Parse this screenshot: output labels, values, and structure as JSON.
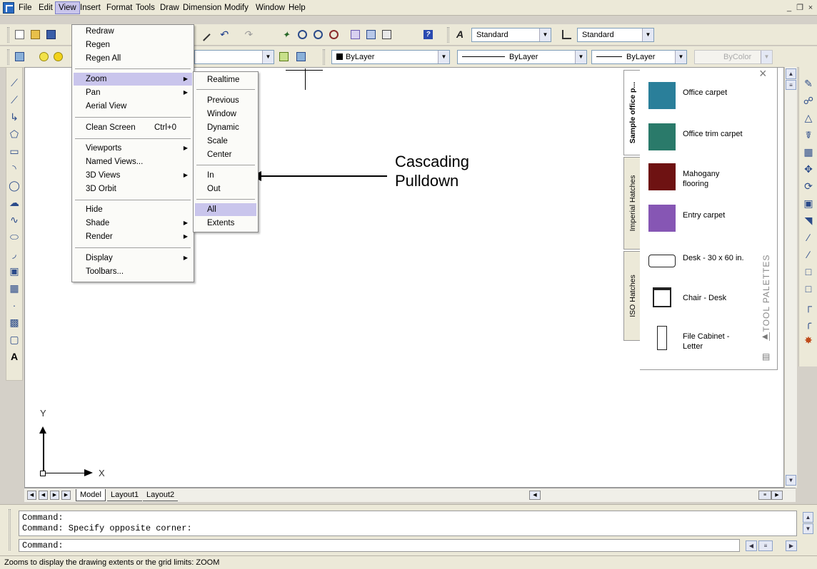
{
  "menubar": {
    "items": [
      "File",
      "Edit",
      "View",
      "Insert",
      "Format",
      "Tools",
      "Draw",
      "Dimension",
      "Modify",
      "Window",
      "Help"
    ],
    "window_controls": [
      "_",
      "ɗ",
      "×"
    ]
  },
  "toolbar": {
    "text_style": "Standard",
    "dim_style": "Standard",
    "layer_color": "ByLayer",
    "linetype": "ByLayer",
    "lineweight": "ByLayer",
    "plot_style": "ByColor"
  },
  "view_menu": {
    "groups": [
      [
        {
          "label": "Redraw"
        },
        {
          "label": "Regen"
        },
        {
          "label": "Regen All"
        }
      ],
      [
        {
          "label": "Zoom",
          "submenu": true,
          "highlighted": true
        },
        {
          "label": "Pan",
          "submenu": true
        },
        {
          "label": "Aerial View"
        }
      ],
      [
        {
          "label": "Clean Screen",
          "shortcut": "Ctrl+0"
        }
      ],
      [
        {
          "label": "Viewports",
          "submenu": true
        },
        {
          "label": "Named Views..."
        },
        {
          "label": "3D Views",
          "submenu": true
        },
        {
          "label": "3D Orbit"
        }
      ],
      [
        {
          "label": "Hide"
        },
        {
          "label": "Shade",
          "submenu": true
        },
        {
          "label": "Render",
          "submenu": true
        }
      ],
      [
        {
          "label": "Display",
          "submenu": true
        },
        {
          "label": "Toolbars..."
        }
      ]
    ]
  },
  "zoom_menu": {
    "groups": [
      [
        {
          "label": "Realtime"
        }
      ],
      [
        {
          "label": "Previous"
        },
        {
          "label": "Window"
        },
        {
          "label": "Dynamic"
        },
        {
          "label": "Scale"
        },
        {
          "label": "Center"
        }
      ],
      [
        {
          "label": "In"
        },
        {
          "label": "Out"
        }
      ],
      [
        {
          "label": "All",
          "highlighted": true
        },
        {
          "label": "Extents"
        }
      ]
    ]
  },
  "annotation": {
    "line1": "Cascading",
    "line2": "Pulldown"
  },
  "palette": {
    "tabs": [
      "Sample office p...",
      "Imperial Hatches",
      "ISO Hatches"
    ],
    "title": "TOOL PALETTES",
    "items": [
      {
        "label": "Office carpet",
        "color": "#2a7f9a"
      },
      {
        "label": "Office trim carpet",
        "color": "#2a7a6a"
      },
      {
        "label": "Mahogany flooring",
        "color": "#6e1212"
      },
      {
        "label": "Entry carpet",
        "color": "#8656b4"
      },
      {
        "label": "Desk - 30 x 60 in.",
        "icon": "desk-icon"
      },
      {
        "label": "Chair - Desk",
        "icon": "chair-icon"
      },
      {
        "label": "File Cabinet - Letter",
        "icon": "file-cabinet-icon"
      }
    ]
  },
  "ucs": {
    "x": "X",
    "y": "Y"
  },
  "layout_tabs": [
    "Model",
    "Layout1",
    "Layout2"
  ],
  "command": {
    "history": [
      "Command:",
      "Command: Specify opposite corner:"
    ],
    "prompt": "Command:"
  },
  "status": "Zooms to display the drawing extents or the grid limits: ZOOM",
  "colors": {
    "menu_highlight": "#c9c5ec",
    "chrome": "#ece9d8"
  }
}
